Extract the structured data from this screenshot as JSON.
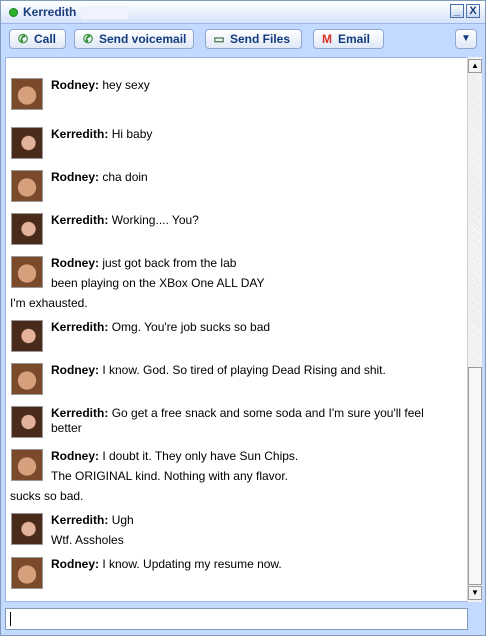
{
  "window": {
    "title": "Kerredith",
    "minimize_icon": "_",
    "close_icon": "X"
  },
  "toolbar": {
    "call_label": "Call",
    "voicemail_label": "Send voicemail",
    "sendfiles_label": "Send Files",
    "email_label": "Email",
    "menu_icon": "▼"
  },
  "messages": [
    {
      "sender": "Rodney:",
      "text": "hey sexy"
    },
    {
      "sender": "Kerredith:",
      "text": "Hi baby"
    },
    {
      "sender": "Rodney:",
      "text": "cha doin"
    },
    {
      "sender": "Kerredith:",
      "text": "Working.... You?"
    },
    {
      "sender": "Rodney:",
      "text": "just got back from the lab",
      "extra": [
        "been playing on the XBox One ALL DAY"
      ],
      "wrap": "I'm exhausted."
    },
    {
      "sender": "Kerredith:",
      "text": "Omg. You're job sucks so bad"
    },
    {
      "sender": "Rodney:",
      "text": "I know. God. So tired of playing Dead Rising and shit."
    },
    {
      "sender": "Kerredith:",
      "text": "Go get a free snack and some soda and I'm sure you'll feel",
      "extra": [
        "better"
      ]
    },
    {
      "sender": "Rodney:",
      "text": "I doubt it. They only have Sun Chips.",
      "extra": [
        "The ORIGINAL kind. Nothing with any flavor."
      ],
      "wrap": "sucks so bad."
    },
    {
      "sender": "Kerredith:",
      "text": "Ugh",
      "extra": [
        "Wtf. Assholes"
      ]
    },
    {
      "sender": "Rodney:",
      "text": "I know. Updating my resume now."
    }
  ],
  "input": {
    "value": ""
  }
}
